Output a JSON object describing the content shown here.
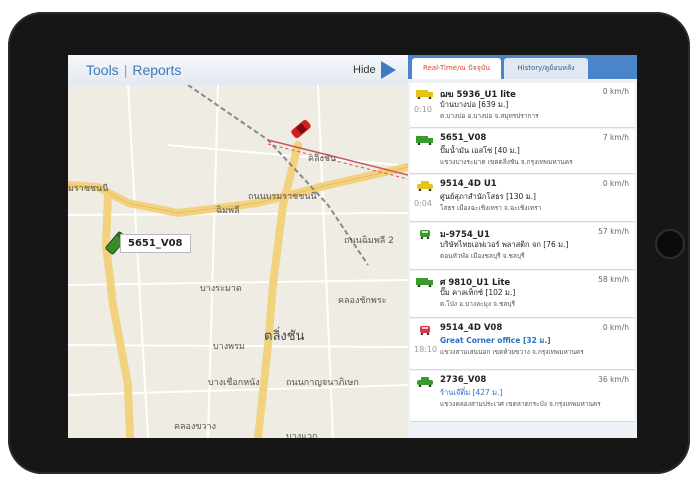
{
  "topbar": {
    "tools_label": "Tools",
    "separator": "|",
    "reports_label": "Reports",
    "hide_label": "Hide"
  },
  "tabs": [
    {
      "label": "Real-Time/ณ ปัจจุบัน",
      "active": true
    },
    {
      "label": "History/ดูย้อนหลัง",
      "active": false
    }
  ],
  "map": {
    "callout_label": "5651_V08",
    "labels": [
      "คลิ่งชัน",
      "มราชชนนี",
      "ถนนบรมราชชนนี",
      "ฉิมพลี",
      "ถนนฉิมพลี 2",
      "บางระมาด",
      "คลองชักพระ",
      "ตลิ่งชัน",
      "บางพรม",
      "บางเชือกหนัง",
      "คลองขวาง",
      "ถนนกาญจนาภิเษก",
      "บางแวก"
    ]
  },
  "vehicles": [
    {
      "name": "ฌฆ 5936_U1 lite",
      "time": "0:10",
      "speed": "0 km/h",
      "location": "บ้านบางบ่อ [639 ม.]",
      "address": "ต.บางบ่อ อ.บางบ่อ จ.สมุทรปราการ",
      "icon": "yellow-truck-icon",
      "color": "#e5c417"
    },
    {
      "name": "5651_V08",
      "time": "",
      "speed": "7 km/h",
      "location": "ปั๊มน้ำมัน เอสโซ่ [40 ม.]",
      "address": "แขวงบางระมาด เขตตลิ่งชัน จ.กรุงเทพมหานคร",
      "icon": "green-truck-icon",
      "color": "#3a9a2c"
    },
    {
      "name": "9514_4D U1",
      "time": "0:04",
      "speed": "0 km/h",
      "location": "ศูนย์สุภาสำนักโสธร [130 ม.]",
      "address": "โสธร เมืองฉะเชิงเทรา จ.ฉะเชิงเทรา",
      "icon": "yellow-car-icon",
      "color": "#e5c417"
    },
    {
      "name": "ม-9754_U1",
      "time": "",
      "speed": "57 km/h",
      "location": "บริษัทไทยเอฟเวอร์ พลาสติก จก [76 ม.]",
      "address": "ดอนหัวฬ่อ เมืองชลบุรี จ.ชลบุรี",
      "icon": "green-car-front-icon",
      "color": "#3a9a2c"
    },
    {
      "name": "ศ 9810_U1 Lite",
      "time": "",
      "speed": "58 km/h",
      "location": "ปั๊ม คาลเท็กซ์ [102 ม.]",
      "address": "ต.โป่ง อ.บางละมุง จ.ชลบุรี",
      "icon": "green-truck-icon",
      "color": "#3a9a2c"
    },
    {
      "name": "9514_4D V08",
      "time": "18:10",
      "speed": "0 km/h",
      "location": "Great Corner office [32 ม.]",
      "address": "แขวงสามเสนนอก เขตห้วยขวาง จ.กรุงเทพมหานคร",
      "icon": "red-car-front-icon",
      "color": "#e0314a",
      "location_highlight": true
    },
    {
      "name": "2736_V08",
      "time": "",
      "speed": "36 km/h",
      "location": "ร้านเจ๊ติ๋ม [427 ม.]",
      "address": "แขวงคลองสามประเวศ เขตลาดกระบัง จ.กรุงเทพมหานคร",
      "icon": "green-car-icon",
      "color": "#3a9a2c"
    }
  ]
}
